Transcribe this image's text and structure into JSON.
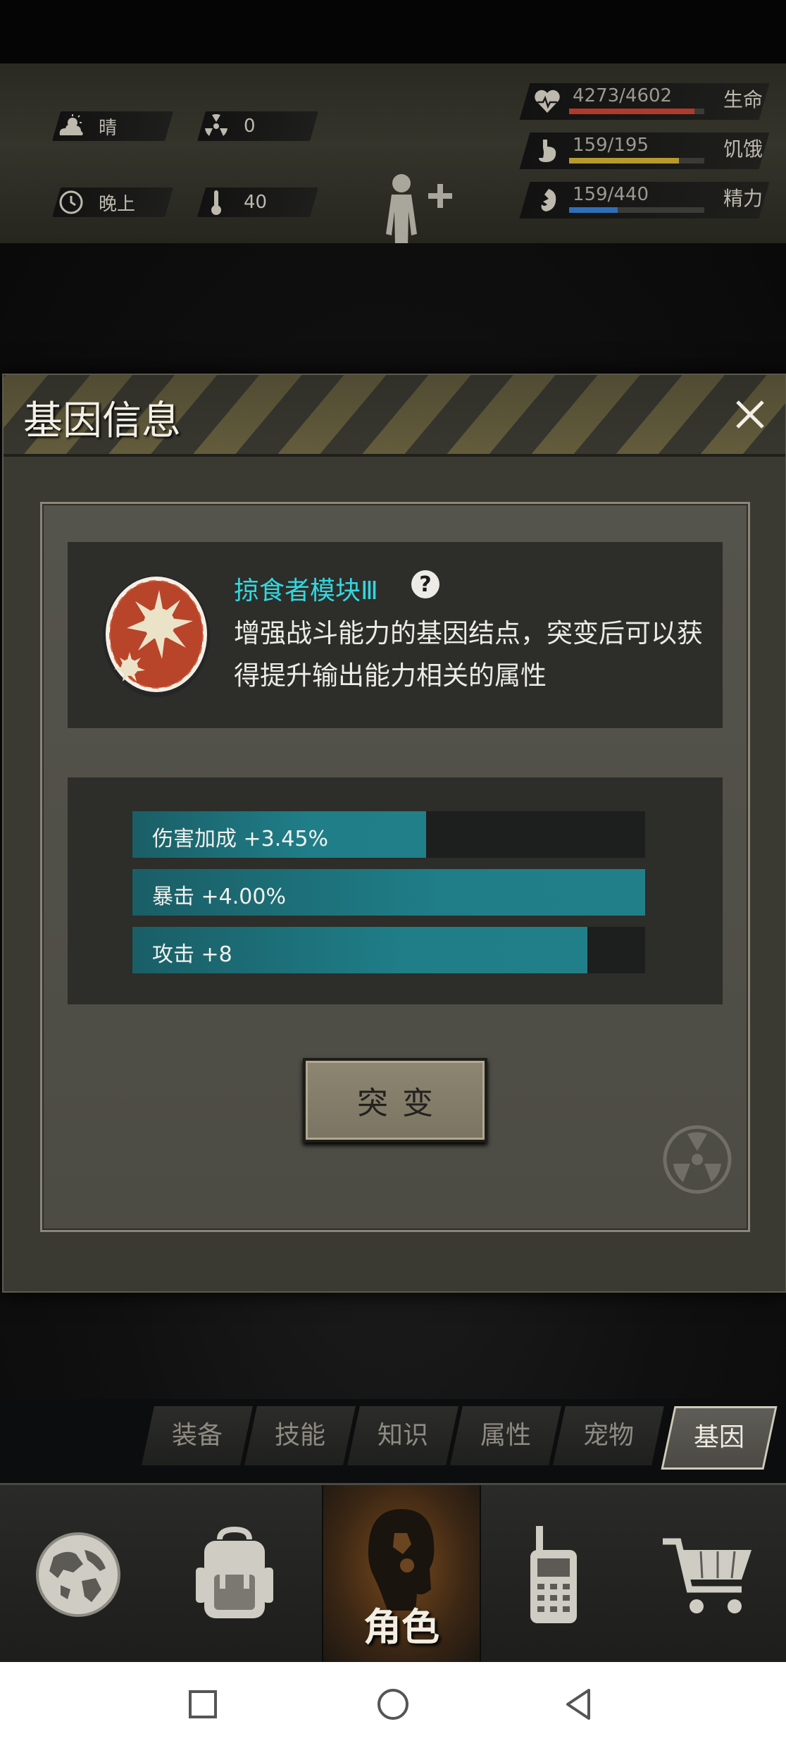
{
  "hud": {
    "weather": "晴",
    "radiation": "0",
    "time_of_day": "晚上",
    "temperature": "40",
    "stats": [
      {
        "name": "生命",
        "value": "4273/4602",
        "fraction": 0.928,
        "color": "#b13a2c",
        "icon": "heart-icon"
      },
      {
        "name": "饥饿",
        "value": "159/195",
        "fraction": 0.815,
        "color": "#b8992e",
        "icon": "stomach-icon"
      },
      {
        "name": "精力",
        "value": "159/440",
        "fraction": 0.361,
        "color": "#2e6fb8",
        "icon": "energy-icon"
      }
    ]
  },
  "dialog": {
    "title": "基因信息",
    "gene_name": "掠食者模块Ⅲ",
    "description": "增强战斗能力的基因结点，突变后可以获得提升输出能力相关的属性",
    "attributes": [
      {
        "label": "伤害加成 +3.45%",
        "fraction": 0.573
      },
      {
        "label": "暴击 +4.00%",
        "fraction": 1.0
      },
      {
        "label": "攻击 +8",
        "fraction": 0.887
      }
    ],
    "mutate_label": "突变"
  },
  "subtabs": [
    "装备",
    "技能",
    "知识",
    "属性",
    "宠物",
    "基因"
  ],
  "active_subtab": "基因",
  "bottomnav": {
    "items": [
      "globe-icon",
      "backpack-icon",
      "character-icon",
      "radio-icon",
      "cart-icon"
    ],
    "active_label": "角色"
  },
  "colors": {
    "accent_cyan": "#31d7e0",
    "bar_teal": "#1f7e88"
  }
}
